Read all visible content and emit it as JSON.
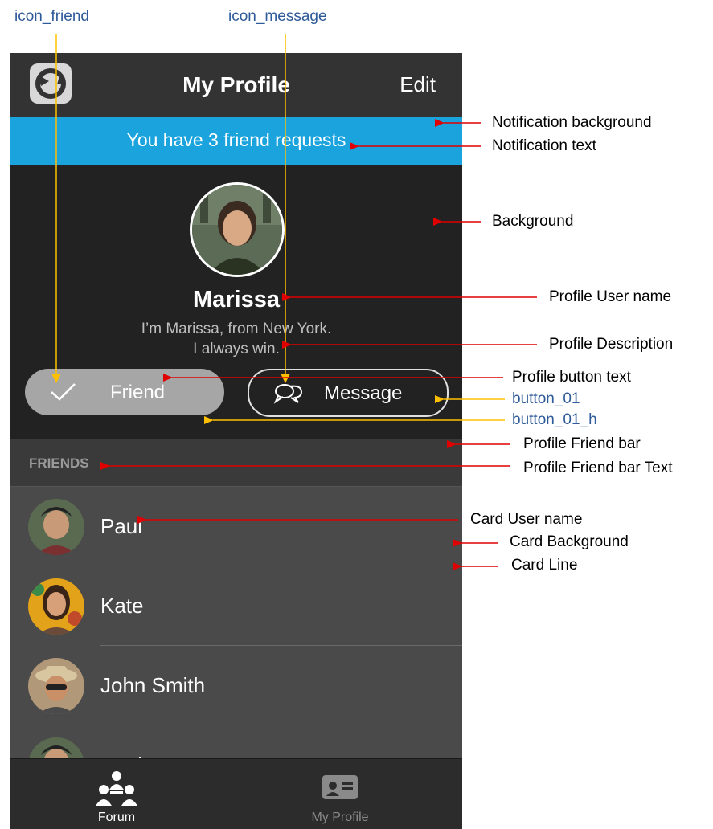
{
  "annotations": {
    "icon_friend": "icon_friend",
    "icon_message": "icon_message",
    "notification_background": "Notification background",
    "notification_text": "Notification text",
    "background": "Background",
    "profile_user_name": "Profile User name",
    "profile_description": "Profile Description",
    "profile_button_text": "Profile button text",
    "button_01": "button_01",
    "button_01_h": "button_01_h",
    "profile_friend_bar": "Profile Friend  bar",
    "profile_friend_bar_text": "Profile Friend  bar Text",
    "card_user_name": "Card User name",
    "card_background": "Card Background",
    "card_line": "Card Line"
  },
  "app": {
    "title": "My Profile",
    "edit_label": "Edit",
    "notification": "You have 3 friend requests",
    "profile": {
      "name": "Marissa",
      "description_line1": "I’m Marissa, from New York.",
      "description_line2": "I always win."
    },
    "buttons": {
      "friend": "Friend",
      "message": "Message"
    },
    "friends_bar": "FRIENDS",
    "friends": [
      {
        "name": "Paul"
      },
      {
        "name": "Kate"
      },
      {
        "name": "John Smith"
      },
      {
        "name": "Paul"
      }
    ],
    "tabs": {
      "forum": "Forum",
      "my_profile": "My Profile"
    }
  },
  "colors": {
    "notification_bg": "#1aa3dd",
    "background": "#222222",
    "card_bg": "#4a4a4a",
    "arrow_red": "#e00000",
    "arrow_yellow": "#ffc000",
    "annotation_blue": "#2e5a99"
  },
  "icons": [
    "logo-icon",
    "check-icon",
    "chat-bubbles-icon",
    "forum-people-icon",
    "id-card-icon"
  ]
}
